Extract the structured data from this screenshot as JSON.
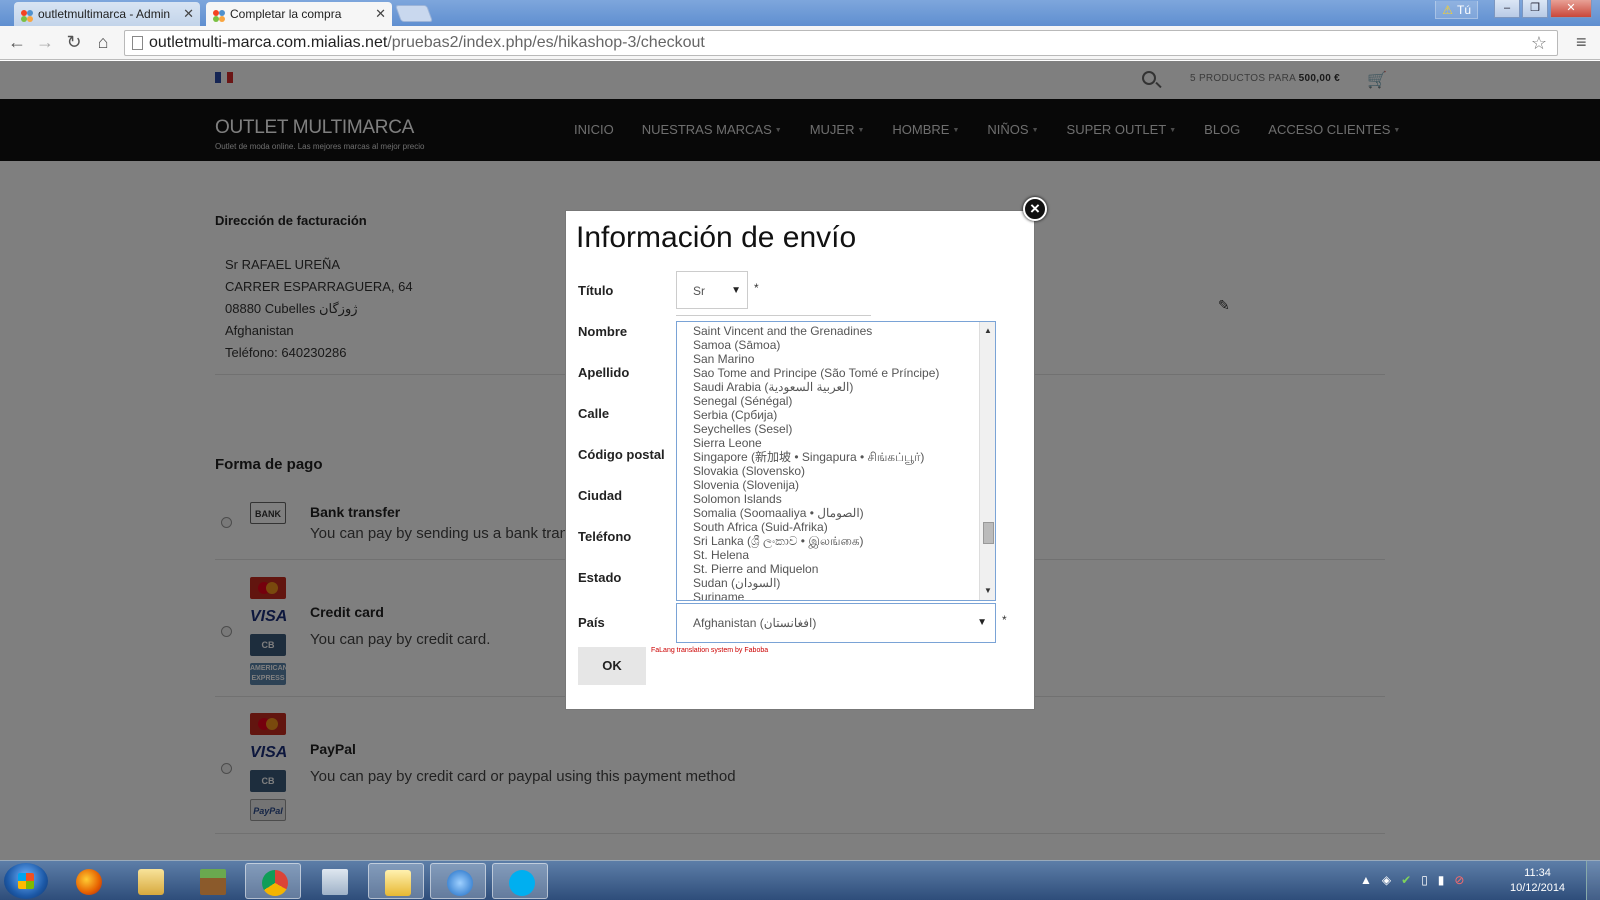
{
  "browser": {
    "tabs": [
      {
        "label": "outletmultimarca - Admin"
      },
      {
        "label": "Completar la compra"
      }
    ],
    "user_badge": "Tú",
    "url_host": "outletmulti-marca.com.mialias.net",
    "url_path": "/pruebas2/index.php/es/hikashop-3/checkout"
  },
  "site": {
    "cart_count_text": "5 PRODUCTOS PARA",
    "cart_total": "500,00 €",
    "brand": "OUTLET MULTIMARCA",
    "tagline": "Outlet de moda online. Las mejores marcas al mejor precio",
    "nav": [
      {
        "label": "INICIO",
        "caret": false
      },
      {
        "label": "NUESTRAS MARCAS",
        "caret": true
      },
      {
        "label": "MUJER",
        "caret": true
      },
      {
        "label": "HOMBRE",
        "caret": true
      },
      {
        "label": "NIÑOS",
        "caret": true
      },
      {
        "label": "SUPER OUTLET",
        "caret": true
      },
      {
        "label": "BLOG",
        "caret": false
      },
      {
        "label": "ACCESO CLIENTES",
        "caret": true
      }
    ]
  },
  "billing": {
    "title": "Dirección de facturación",
    "lines": [
      "Sr RAFAEL UREÑA",
      "CARRER ESPARRAGUERA, 64",
      "08880 Cubelles ژوزگان",
      "Afghanistan",
      "Teléfono: 640230286"
    ]
  },
  "payment": {
    "title": "Forma de pago",
    "methods": [
      {
        "title": "Bank transfer",
        "desc": "You can pay by sending us a bank transfer."
      },
      {
        "title": "Credit card",
        "desc": "You can pay by credit card."
      },
      {
        "title": "PayPal",
        "desc": "You can pay by credit card or paypal using this payment method"
      }
    ],
    "logos": {
      "bank": "BANK",
      "visa": "VISA",
      "cb": "CB",
      "amex": "AMERICAN EXPRESS",
      "paypal": "PayPal"
    }
  },
  "modal": {
    "title": "Información de envío",
    "labels": {
      "titulo": "Título",
      "nombre": "Nombre",
      "apellido": "Apellido",
      "calle": "Calle",
      "codigo_postal": "Código postal",
      "ciudad": "Ciudad",
      "telefono": "Teléfono",
      "estado": "Estado",
      "pais": "País"
    },
    "titulo_value": "Sr",
    "required_mark": "*",
    "country_list": [
      "Saint Vincent and the Grenadines",
      "Samoa (Sāmoa)",
      "San Marino",
      "Sao Tome and Principe (São Tomé e Príncipe)",
      "Saudi Arabia (العربية السعودية)",
      "Senegal (Sénégal)",
      "Serbia (Србија)",
      "Seychelles (Sesel)",
      "Sierra Leone",
      "Singapore (新加坡 • Singapura • சிங்கப்பூர்)",
      "Slovakia (Slovensko)",
      "Slovenia (Slovenija)",
      "Solomon Islands",
      "Somalia (Soomaaliya • الصومال)",
      "South Africa (Suid-Afrika)",
      "Sri Lanka (ශ්‍රී ලංකාව • இலங்கை)",
      "St. Helena",
      "St. Pierre and Miquelon",
      "Sudan (السودان)",
      "Suriname"
    ],
    "pais_value": "Afghanistan (افغانستان)",
    "falang": "FaLang translation system by Faboba",
    "ok_label": "OK",
    "close_glyph": "×"
  },
  "taskbar": {
    "time": "11:34",
    "date": "10/12/2014"
  }
}
